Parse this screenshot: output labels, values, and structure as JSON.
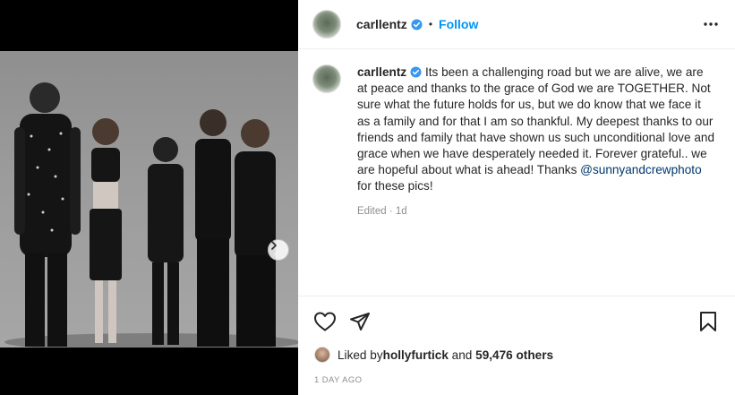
{
  "post": {
    "username": "carllentz",
    "follow_label": "Follow",
    "separator": "•",
    "caption": "Its been a challenging road but we are alive, we are at peace and thanks to the grace of God we are TOGETHER. Not sure what the future holds for us, but we do know that we face it as a family and for that I am so thankful. My deepest thanks to our friends and family that have shown us such unconditional love and grace when we have desperately needed it. Forever grateful.. we are hopeful about what is ahead! Thanks ",
    "mention": "@sunnyandcrewphoto",
    "caption_end": " for these pics!",
    "edited": "Edited",
    "meta_sep": " · ",
    "age": "1d",
    "likes_prefix": "Liked by ",
    "liked_by": "hollyfurtick",
    "likes_mid": " and ",
    "likes_others": "59,476 others",
    "date": "1 DAY AGO"
  },
  "carousel": {
    "slides": 4,
    "active_index": 0
  },
  "colors": {
    "accent": "#0095f6",
    "verified": "#3897f0",
    "link": "#00376b",
    "muted": "#8e8e8e"
  },
  "icons": [
    "verified-badge-icon",
    "more-icon",
    "chevron-right-icon",
    "heart-icon",
    "share-icon",
    "bookmark-icon"
  ]
}
